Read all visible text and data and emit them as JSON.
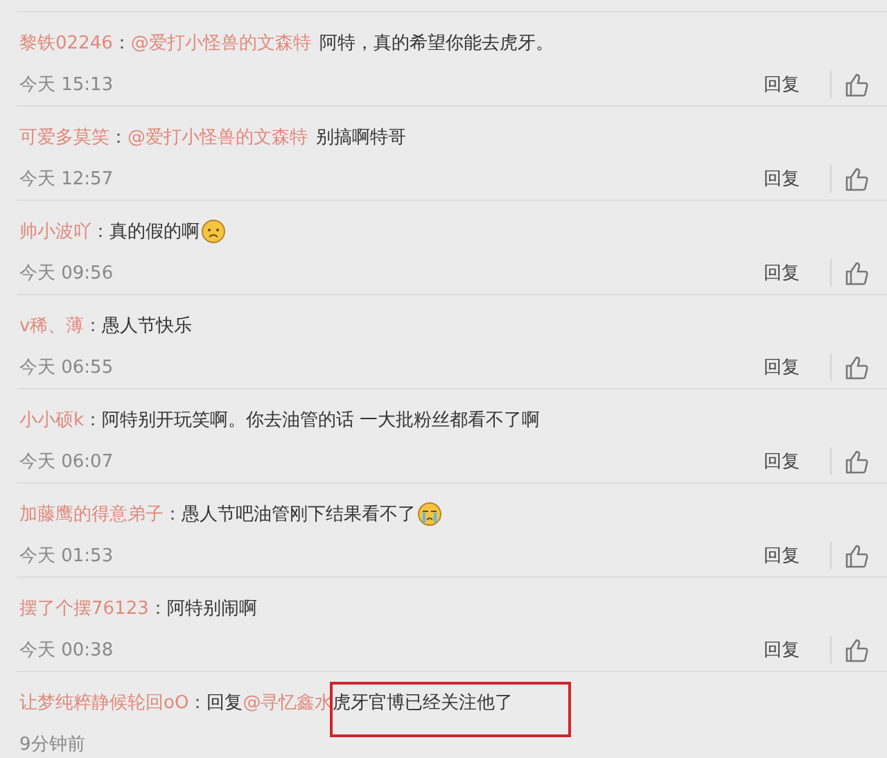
{
  "comments": [
    {
      "user": "黎铁02246",
      "separator": "：",
      "mention": "@爱打小怪兽的文森特",
      "text": "阿特，真的希望你能去虎牙。",
      "time": "今天 15:13",
      "reply_label": "回复",
      "can_like": true
    },
    {
      "user": "可爱多莫笑",
      "separator": "：",
      "mention": "@爱打小怪兽的文森特",
      "text": "别搞啊特哥",
      "time": "今天 12:57",
      "reply_label": "回复",
      "can_like": true
    },
    {
      "user": "帅小波吖",
      "separator": "：",
      "text": "真的假的啊",
      "emoji": {
        "kind": "sad"
      },
      "time": "今天 09:56",
      "reply_label": "回复",
      "can_like": true
    },
    {
      "user": "v稀、薄",
      "separator": "：",
      "text": "愚人节快乐",
      "time": "今天 06:55",
      "reply_label": "回复",
      "can_like": true
    },
    {
      "user": "小小硕k",
      "separator": "：",
      "text": "阿特别开玩笑啊。你去油管的话  一大批粉丝都看不了啊",
      "time": "今天 06:07",
      "reply_label": "回复",
      "can_like": true
    },
    {
      "user": "加藤鹰的得意弟子",
      "separator": "：",
      "text": "愚人节吧油管刚下结果看不了",
      "emoji": {
        "kind": "cry"
      },
      "time": "今天 01:53",
      "reply_label": "回复",
      "can_like": true
    },
    {
      "user": "摆了个摆76123",
      "separator": "：",
      "text": "阿特别闹啊",
      "time": "今天 00:38",
      "reply_label": "回复",
      "can_like": true
    },
    {
      "user": "让梦纯粹静候轮回oO",
      "separator": "：",
      "prefix": "回复",
      "mention": "@寻忆鑫水",
      "text": "虎牙官博已经关注他了",
      "text_highlighted": true,
      "time": "9分钟前",
      "can_like": false
    }
  ]
}
